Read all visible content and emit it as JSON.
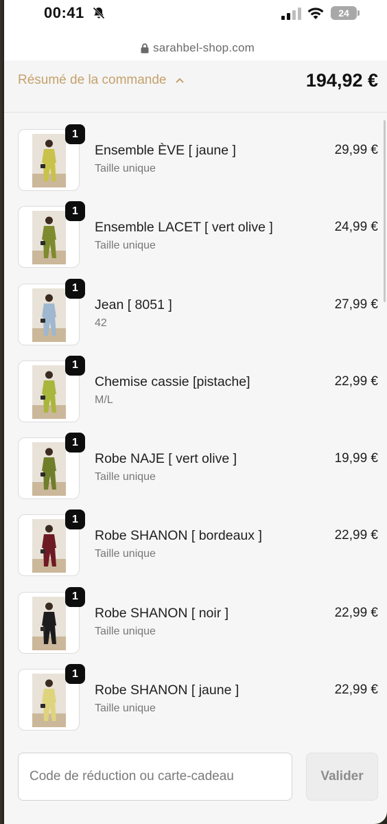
{
  "status_bar": {
    "time": "00:41",
    "battery": "24"
  },
  "browser": {
    "url": "sarahbel-shop.com"
  },
  "summary": {
    "label": "Résumé de la commande",
    "total": "194,92 €"
  },
  "items": [
    {
      "qty": "1",
      "name": "Ensemble ÈVE [ jaune ]",
      "variant": "Taille unique",
      "price": "29,99 €",
      "color": "#c9c24a"
    },
    {
      "qty": "1",
      "name": "Ensemble LACET [ vert olive ]",
      "variant": "Taille unique",
      "price": "24,99 €",
      "color": "#7d8a2e"
    },
    {
      "qty": "1",
      "name": "Jean [ 8051 ]",
      "variant": "42",
      "price": "27,99 €",
      "color": "#9fb7cf"
    },
    {
      "qty": "1",
      "name": "Chemise cassie [pistache]",
      "variant": "M/L",
      "price": "22,99 €",
      "color": "#a9b63c"
    },
    {
      "qty": "1",
      "name": "Robe NAJE [ vert olive ]",
      "variant": "Taille unique",
      "price": "19,99 €",
      "color": "#6f7e2a"
    },
    {
      "qty": "1",
      "name": "Robe SHANON [ bordeaux ]",
      "variant": "Taille unique",
      "price": "22,99 €",
      "color": "#6e1a24"
    },
    {
      "qty": "1",
      "name": "Robe SHANON [ noir ]",
      "variant": "Taille unique",
      "price": "22,99 €",
      "color": "#1c1c1c"
    },
    {
      "qty": "1",
      "name": "Robe SHANON [ jaune ]",
      "variant": "Taille unique",
      "price": "22,99 €",
      "color": "#dfd47e"
    }
  ],
  "discount": {
    "placeholder": "Code de réduction ou carte-cadeau",
    "button_label": "Valider"
  }
}
